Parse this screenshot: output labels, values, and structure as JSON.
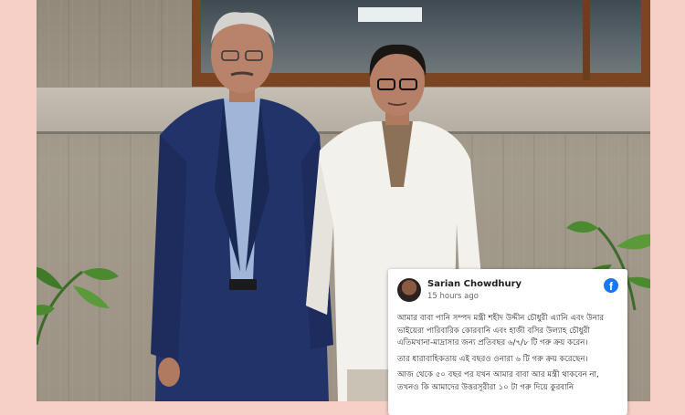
{
  "post": {
    "author": "Sarian Chowdhury",
    "time": "15 hours ago",
    "logo": "facebook-icon",
    "paragraphs": [
      "আমার বাবা পানি সম্পদ মন্ত্রী শহীদ উদ্দীন চৌধুরী এ্যানি এবং উনার ভাইয়েরা পারিবারিক কোরবানি এবং হাজী বসির উল্যাহ চৌধুরী এতিমখানা-মাদ্রাসার জন্য প্রতিবছর ৬/৭/৮ টি গরু ক্রয় করেন।",
      "তার ধারাবাহিকতায় এই বছরও ওনারা ৬ টি গরু ক্রয় করেছেন।",
      "আজ থেকে ৫০ বছর পর যখন আমার বাবা আর মন্ত্রী থাকবেন না, তখনও কি আমাদের উত্তরসূরীরা ১০ টা গরু দিয়ে কুরবানি"
    ]
  },
  "colors": {
    "background": "#f6cfc6",
    "facebook_blue": "#1877f2",
    "window_frame": "#7a4522"
  }
}
